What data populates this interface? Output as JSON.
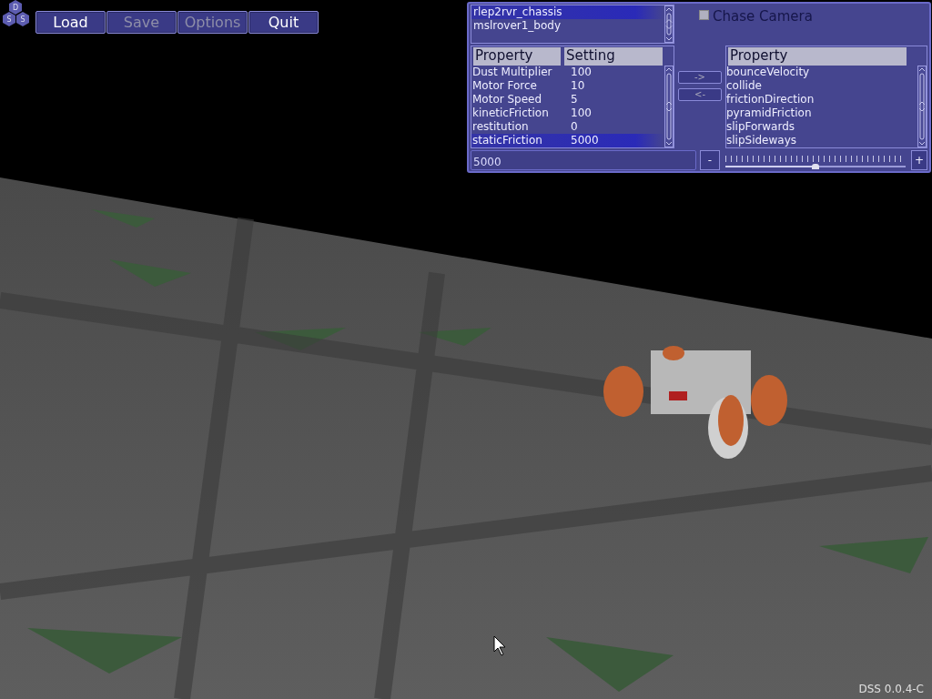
{
  "logo": {
    "letters": [
      "D",
      "S",
      "S"
    ]
  },
  "toolbar": {
    "buttons": [
      {
        "label": "Load",
        "disabled": false
      },
      {
        "label": "Save",
        "disabled": true
      },
      {
        "label": "Options",
        "disabled": true
      },
      {
        "label": "Quit",
        "disabled": false
      }
    ]
  },
  "objects": [
    {
      "name": "rlep2rvr_chassis",
      "selected": true
    },
    {
      "name": "mslrover1_body",
      "selected": false
    }
  ],
  "chase_camera": {
    "label": "Chase Camera",
    "checked": false
  },
  "properties": {
    "columns": [
      "Property",
      "Setting"
    ],
    "rows": [
      {
        "property": "Dust Multiplier",
        "setting": "100",
        "selected": false
      },
      {
        "property": "Motor Force",
        "setting": "10",
        "selected": false
      },
      {
        "property": "Motor Speed",
        "setting": "5",
        "selected": false
      },
      {
        "property": "kineticFriction",
        "setting": "100",
        "selected": false
      },
      {
        "property": "restitution",
        "setting": "0",
        "selected": false
      },
      {
        "property": "staticFriction",
        "setting": "5000",
        "selected": true
      }
    ]
  },
  "transfer_buttons": [
    "->",
    "<-"
  ],
  "available": {
    "column": "Property",
    "items": [
      "bounceVelocity",
      "collide",
      "frictionDirection",
      "pyramidFriction",
      "slipForwards",
      "slipSideways"
    ]
  },
  "value_field": {
    "value": "5000"
  },
  "minus_button": "-",
  "slider": {
    "level": 0.5
  },
  "plus_button": "+",
  "version": "DSS 0.0.4-C"
}
